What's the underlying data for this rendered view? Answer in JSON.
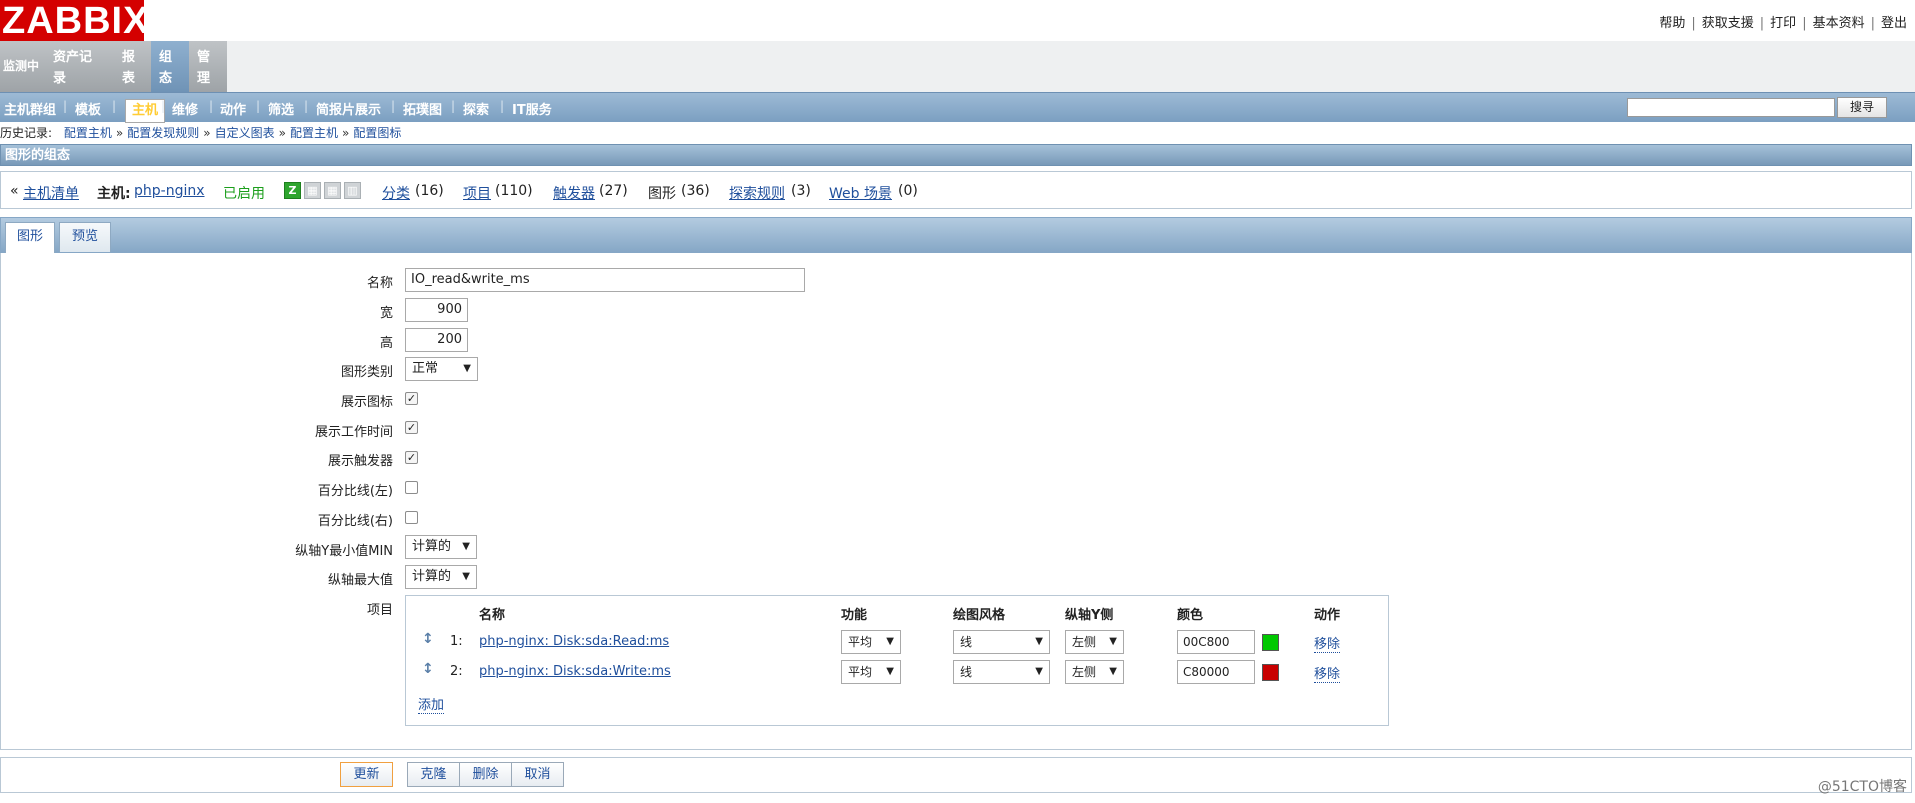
{
  "logo": "ZABBIX",
  "top_links": [
    "帮助",
    "获取支援",
    "打印",
    "基本资料",
    "登出"
  ],
  "main_menu": [
    {
      "label": "监测中",
      "lines": [
        "监测中"
      ]
    },
    {
      "label": "资产记录",
      "lines": [
        "资产记",
        "录"
      ]
    },
    {
      "label": "报表",
      "lines": [
        "报",
        "表"
      ]
    },
    {
      "label": "组态",
      "lines": [
        "组",
        "态"
      ]
    },
    {
      "label": "管理",
      "lines": [
        "管",
        "理"
      ]
    }
  ],
  "submenu": [
    "主机群组",
    "模板",
    "主机",
    "维修",
    "动作",
    "筛选",
    "简报片展示",
    "拓璞图",
    "探索",
    "IT服务"
  ],
  "search": {
    "button": "搜寻",
    "value": ""
  },
  "history": {
    "label": "历史记录:",
    "items": [
      "配置主机",
      "配置发现规则",
      "自定义图表",
      "配置主机",
      "配置图标"
    ]
  },
  "section_title": "图形的组态",
  "host_bar": {
    "back_prefix": "«",
    "host_list": "主机清单",
    "host_label": "主机:",
    "host_name": "php-nginx",
    "status": "已启用",
    "avail_z": "Z",
    "applications": "分类",
    "applications_count": "(16)",
    "items": "项目",
    "items_count": "(110)",
    "triggers": "触发器",
    "triggers_count": "(27)",
    "graphs": "图形",
    "graphs_count": "(36)",
    "discovery": "探索规则",
    "discovery_count": "(3)",
    "web": "Web 场景",
    "web_count": "(0)"
  },
  "tabs": [
    "图形",
    "预览"
  ],
  "form": {
    "name_label": "名称",
    "name_value": "IO_read&write_ms",
    "width_label": "宽",
    "width_value": "900",
    "height_label": "高",
    "height_value": "200",
    "type_label": "图形类别",
    "type_value": "正常",
    "show_legend_label": "展示图标",
    "show_legend": true,
    "show_worktime_label": "展示工作时间",
    "show_worktime": true,
    "show_triggers_label": "展示触发器",
    "show_triggers": true,
    "percent_left_label": "百分比线(左)",
    "percent_left": false,
    "percent_right_label": "百分比线(右)",
    "percent_right": false,
    "ymin_label": "纵轴Y最小值MIN",
    "ymin_value": "计算的",
    "ymax_label": "纵轴最大值",
    "ymax_value": "计算的",
    "items_label": "项目"
  },
  "items_table": {
    "headers": {
      "name": "名称",
      "function": "功能",
      "draw_style": "绘图风格",
      "y_axis": "纵轴Y侧",
      "color": "颜色",
      "action": "动作"
    },
    "rows": [
      {
        "num": "1:",
        "name": "php-nginx: Disk:sda:Read:ms",
        "function": "平均",
        "draw_style": "线",
        "y_axis": "左侧",
        "color": "00C800",
        "color_hex": "#00C800",
        "action": "移除"
      },
      {
        "num": "2:",
        "name": "php-nginx: Disk:sda:Write:ms",
        "function": "平均",
        "draw_style": "线",
        "y_axis": "左侧",
        "color": "C80000",
        "color_hex": "#C80000",
        "action": "移除"
      }
    ],
    "add": "添加"
  },
  "buttons": {
    "update": "更新",
    "clone": "克隆",
    "delete": "删除",
    "cancel": "取消"
  },
  "watermark": "@51CTO博客",
  "colors": {
    "logo": "#d40000",
    "menu_active": "#7899b8",
    "submenu_selected": "#ffcc33",
    "enabled": "#1b9e1b",
    "link": "#1f4f9c"
  }
}
